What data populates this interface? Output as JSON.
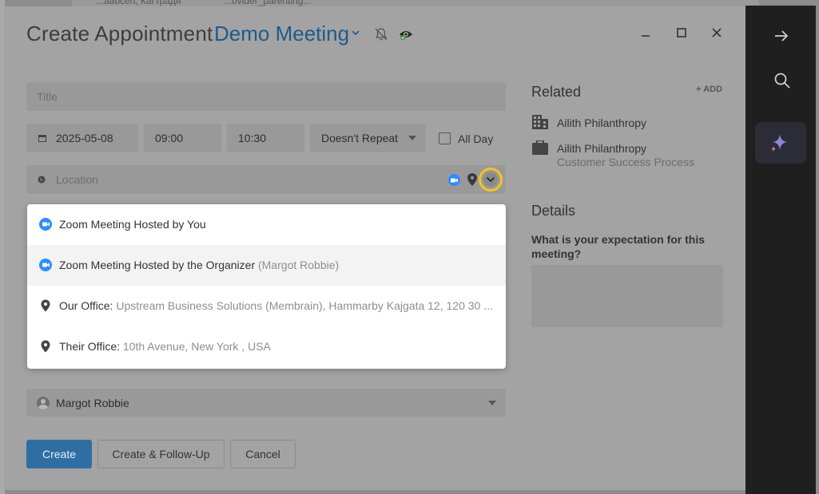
{
  "background": {
    "top_items": [
      "...aabcen, Кагтрадя",
      "...ovider_parenting..."
    ]
  },
  "header": {
    "title": "Create Appointment",
    "type": "Demo Meeting"
  },
  "form": {
    "title_placeholder": "Title",
    "date": "2025-05-08",
    "start_time": "09:00",
    "end_time": "10:30",
    "repeat": "Doesn't Repeat",
    "all_day_label": "All Day",
    "location_placeholder": "Location",
    "owner": "Margot Robbie"
  },
  "location_options": [
    {
      "label": "Zoom Meeting Hosted by You",
      "detail": "",
      "icon": "zoom-icon"
    },
    {
      "label": "Zoom Meeting Hosted by the Organizer",
      "detail": "(Margot Robbie)",
      "icon": "zoom-icon"
    },
    {
      "label": "Our Office:",
      "detail": "Upstream Business Solutions (Membrain), Hammarby Kajgata 12, 120 30 ...",
      "icon": "map-pin-icon"
    },
    {
      "label": "Their Office:",
      "detail": "10th Avenue, New York , USA",
      "icon": "map-pin-icon"
    }
  ],
  "buttons": {
    "create": "Create",
    "create_followup": "Create & Follow-Up",
    "cancel": "Cancel"
  },
  "related": {
    "title": "Related",
    "add_label": "+ ADD",
    "items": [
      {
        "name": "Ailith Philanthropy",
        "sub": "",
        "icon": "building-icon"
      },
      {
        "name": "Ailith Philanthropy",
        "sub": "Customer Success Process",
        "icon": "briefcase-icon"
      }
    ]
  },
  "details": {
    "title": "Details",
    "question": "What is your expectation for this meeting?"
  },
  "colors": {
    "accent": "#1f5a8c",
    "primary_button": "#2f6ea3",
    "zoom": "#2d8cff",
    "highlight_ring": "#f5c518"
  }
}
